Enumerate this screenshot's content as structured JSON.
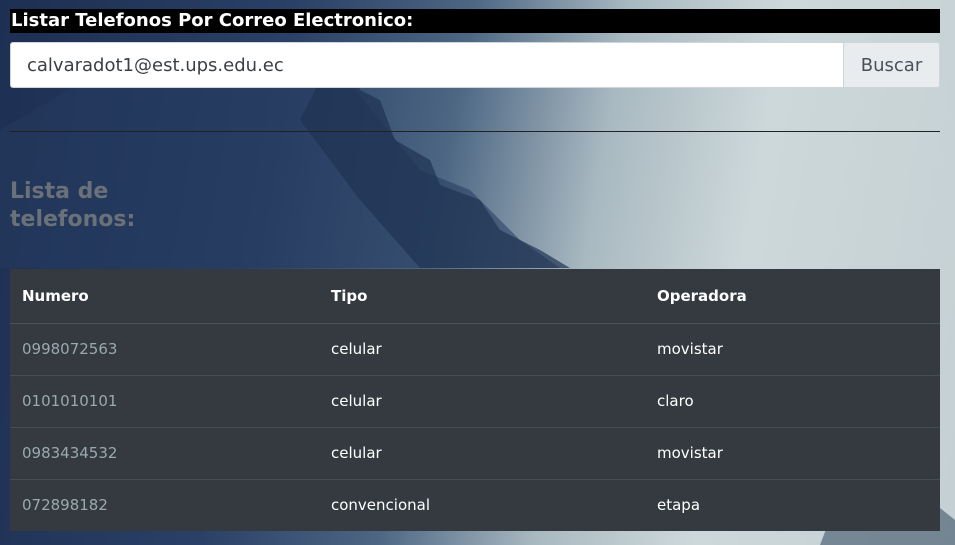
{
  "page": {
    "title": "Listar Telefonos Por Correo Electronico:"
  },
  "search": {
    "value": "calvaradot1@est.ups.edu.ec",
    "button_label": "Buscar"
  },
  "list": {
    "title": "Lista de telefonos:",
    "columns": [
      "Numero",
      "Tipo",
      "Operadora"
    ],
    "rows": [
      {
        "numero": "0998072563",
        "tipo": "celular",
        "operadora": "movistar"
      },
      {
        "numero": "0101010101",
        "tipo": "celular",
        "operadora": "claro"
      },
      {
        "numero": "0983434532",
        "tipo": "celular",
        "operadora": "movistar"
      },
      {
        "numero": "072898182",
        "tipo": "convencional",
        "operadora": "etapa"
      }
    ]
  },
  "colors": {
    "table_bg": "#343a40",
    "title_bg": "#000000",
    "number_link": "#9aa9b0"
  }
}
